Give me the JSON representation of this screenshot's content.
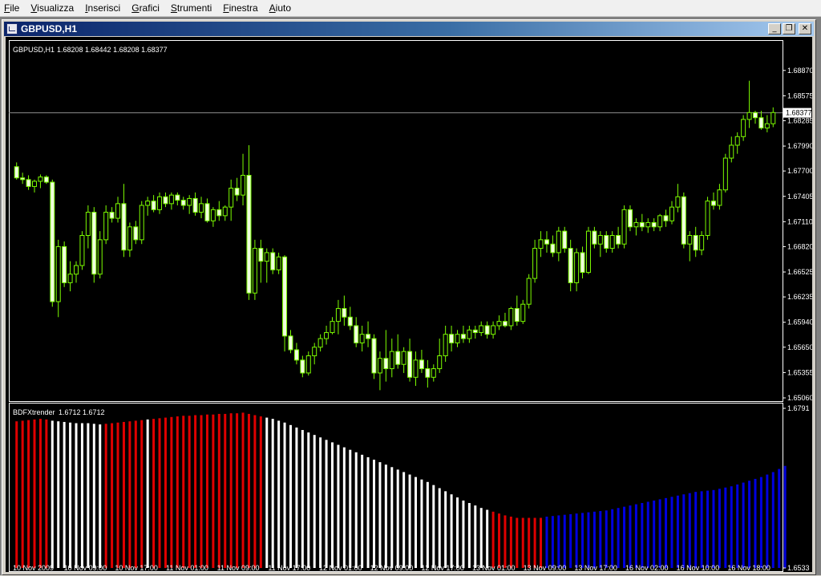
{
  "menu": [
    {
      "label": "File",
      "hotkey": "F",
      "rest": "ile"
    },
    {
      "label": "Visualizza",
      "hotkey": "V",
      "rest": "isualizza"
    },
    {
      "label": "Inserisci",
      "hotkey": "I",
      "rest": "nserisci"
    },
    {
      "label": "Grafici",
      "hotkey": "G",
      "rest": "rafici"
    },
    {
      "label": "Strumenti",
      "hotkey": "S",
      "rest": "trumenti"
    },
    {
      "label": "Finestra",
      "hotkey": "F",
      "rest": "inestra"
    },
    {
      "label": "Aiuto",
      "hotkey": "A",
      "rest": "iuto"
    }
  ],
  "window": {
    "title": "GBPUSD,H1",
    "minimize_glyph": "_",
    "restore_glyph": "❐",
    "close_glyph": "✕"
  },
  "colors": {
    "background": "#000000",
    "grid_axis": "#ffffff",
    "candle": "#7cfc00",
    "bull_fill": "#000000",
    "bear_fill": "#f0ffe0",
    "price_line": "#8c8c8c",
    "hist_red": "#e00000",
    "hist_white": "#ffffff",
    "hist_blue": "#0000e0",
    "text": "#ffffff"
  },
  "chart_data": [
    {
      "type": "candlestick",
      "title": "GBPUSD,H1",
      "ohlc_readout": "1.68208 1.68442 1.68208 1.68377",
      "current_price": "1.68377",
      "ylim": [
        1.6506,
        1.6898
      ],
      "y_ticks": [
        "1.68870",
        "1.68575",
        "1.68285",
        "1.67990",
        "1.67700",
        "1.67405",
        "1.67110",
        "1.66820",
        "1.66525",
        "1.66235",
        "1.65940",
        "1.65650",
        "1.65355",
        "1.65060"
      ],
      "candles": [
        [
          1.6775,
          1.678,
          1.676,
          1.6762
        ],
        [
          1.6762,
          1.6768,
          1.6755,
          1.676
        ],
        [
          1.676,
          1.6765,
          1.6748,
          1.6752
        ],
        [
          1.6752,
          1.676,
          1.6745,
          1.6758
        ],
        [
          1.6758,
          1.6766,
          1.675,
          1.6763
        ],
        [
          1.6763,
          1.6765,
          1.6755,
          1.6757
        ],
        [
          1.6757,
          1.676,
          1.6612,
          1.6618
        ],
        [
          1.6618,
          1.669,
          1.66,
          1.6682
        ],
        [
          1.6682,
          1.6688,
          1.6635,
          1.664
        ],
        [
          1.664,
          1.6665,
          1.663,
          1.665
        ],
        [
          1.665,
          1.6665,
          1.664,
          1.666
        ],
        [
          1.666,
          1.67,
          1.6655,
          1.6695
        ],
        [
          1.6695,
          1.673,
          1.668,
          1.6722
        ],
        [
          1.6722,
          1.6728,
          1.664,
          1.665
        ],
        [
          1.665,
          1.67,
          1.6645,
          1.669
        ],
        [
          1.669,
          1.673,
          1.6685,
          1.6722
        ],
        [
          1.6722,
          1.6728,
          1.671,
          1.6715
        ],
        [
          1.6715,
          1.674,
          1.671,
          1.6732
        ],
        [
          1.6732,
          1.6755,
          1.667,
          1.6678
        ],
        [
          1.6678,
          1.671,
          1.667,
          1.6705
        ],
        [
          1.6705,
          1.6712,
          1.6685,
          1.669
        ],
        [
          1.669,
          1.6735,
          1.6685,
          1.673
        ],
        [
          1.673,
          1.674,
          1.6718,
          1.6735
        ],
        [
          1.6735,
          1.6742,
          1.6722,
          1.6725
        ],
        [
          1.6725,
          1.6745,
          1.672,
          1.674
        ],
        [
          1.674,
          1.6745,
          1.6728,
          1.6732
        ],
        [
          1.6732,
          1.6745,
          1.6725,
          1.6742
        ],
        [
          1.6742,
          1.6745,
          1.673,
          1.6736
        ],
        [
          1.6736,
          1.674,
          1.6725,
          1.673
        ],
        [
          1.673,
          1.6742,
          1.672,
          1.6738
        ],
        [
          1.6738,
          1.6745,
          1.6718,
          1.6722
        ],
        [
          1.6722,
          1.674,
          1.6715,
          1.6732
        ],
        [
          1.6732,
          1.6738,
          1.671,
          1.6712
        ],
        [
          1.6712,
          1.6728,
          1.6705,
          1.6725
        ],
        [
          1.6725,
          1.6735,
          1.6712,
          1.6718
        ],
        [
          1.6718,
          1.673,
          1.6712,
          1.6728
        ],
        [
          1.6728,
          1.676,
          1.6712,
          1.675
        ],
        [
          1.675,
          1.6762,
          1.6735,
          1.6742
        ],
        [
          1.6742,
          1.679,
          1.673,
          1.6765
        ],
        [
          1.6765,
          1.68,
          1.662,
          1.6628
        ],
        [
          1.6628,
          1.669,
          1.662,
          1.668
        ],
        [
          1.668,
          1.669,
          1.664,
          1.6665
        ],
        [
          1.6665,
          1.668,
          1.664,
          1.6675
        ],
        [
          1.6675,
          1.668,
          1.665,
          1.6655
        ],
        [
          1.6655,
          1.6675,
          1.665,
          1.667
        ],
        [
          1.667,
          1.6672,
          1.656,
          1.6578
        ],
        [
          1.6578,
          1.6585,
          1.6558,
          1.6562
        ],
        [
          1.6562,
          1.657,
          1.6545,
          1.655
        ],
        [
          1.655,
          1.6555,
          1.653,
          1.6535
        ],
        [
          1.6535,
          1.656,
          1.6532,
          1.6555
        ],
        [
          1.6555,
          1.657,
          1.6545,
          1.6565
        ],
        [
          1.6565,
          1.658,
          1.656,
          1.6575
        ],
        [
          1.6575,
          1.659,
          1.6568,
          1.6582
        ],
        [
          1.6582,
          1.66,
          1.658,
          1.6595
        ],
        [
          1.6595,
          1.662,
          1.658,
          1.661
        ],
        [
          1.661,
          1.6625,
          1.659,
          1.66
        ],
        [
          1.66,
          1.6612,
          1.6585,
          1.659
        ],
        [
          1.659,
          1.66,
          1.6565,
          1.657
        ],
        [
          1.657,
          1.659,
          1.656,
          1.658
        ],
        [
          1.658,
          1.6595,
          1.6565,
          1.6575
        ],
        [
          1.6575,
          1.658,
          1.6528,
          1.6535
        ],
        [
          1.6535,
          1.656,
          1.6515,
          1.6552
        ],
        [
          1.6552,
          1.6585,
          1.6525,
          1.654
        ],
        [
          1.654,
          1.6575,
          1.653,
          1.656
        ],
        [
          1.656,
          1.658,
          1.654,
          1.6545
        ],
        [
          1.6545,
          1.6565,
          1.6535,
          1.656
        ],
        [
          1.656,
          1.6575,
          1.6525,
          1.653
        ],
        [
          1.653,
          1.656,
          1.652,
          1.655
        ],
        [
          1.655,
          1.6562,
          1.6535,
          1.654
        ],
        [
          1.654,
          1.655,
          1.6518,
          1.653
        ],
        [
          1.653,
          1.6545,
          1.6525,
          1.654
        ],
        [
          1.654,
          1.6575,
          1.6535,
          1.6555
        ],
        [
          1.6555,
          1.659,
          1.6548,
          1.658
        ],
        [
          1.658,
          1.659,
          1.656,
          1.657
        ],
        [
          1.657,
          1.6585,
          1.6565,
          1.658
        ],
        [
          1.658,
          1.659,
          1.657,
          1.6575
        ],
        [
          1.6575,
          1.659,
          1.657,
          1.6585
        ],
        [
          1.6585,
          1.659,
          1.6575,
          1.6582
        ],
        [
          1.6582,
          1.6595,
          1.6578,
          1.659
        ],
        [
          1.659,
          1.6595,
          1.6575,
          1.658
        ],
        [
          1.658,
          1.6595,
          1.6575,
          1.659
        ],
        [
          1.659,
          1.6602,
          1.6585,
          1.6595
        ],
        [
          1.6595,
          1.6605,
          1.6588,
          1.659
        ],
        [
          1.659,
          1.6612,
          1.6585,
          1.661
        ],
        [
          1.661,
          1.6625,
          1.659,
          1.6595
        ],
        [
          1.6595,
          1.662,
          1.6592,
          1.6615
        ],
        [
          1.6615,
          1.665,
          1.661,
          1.6645
        ],
        [
          1.6645,
          1.669,
          1.664,
          1.668
        ],
        [
          1.668,
          1.67,
          1.667,
          1.669
        ],
        [
          1.669,
          1.67,
          1.6675,
          1.6685
        ],
        [
          1.6685,
          1.6695,
          1.667,
          1.6675
        ],
        [
          1.6675,
          1.6705,
          1.6665,
          1.67
        ],
        [
          1.67,
          1.6705,
          1.6675,
          1.668
        ],
        [
          1.668,
          1.669,
          1.663,
          1.664
        ],
        [
          1.664,
          1.668,
          1.663,
          1.6675
        ],
        [
          1.6675,
          1.6682,
          1.6645,
          1.6652
        ],
        [
          1.6652,
          1.6705,
          1.665,
          1.67
        ],
        [
          1.67,
          1.6705,
          1.668,
          1.6685
        ],
        [
          1.6685,
          1.67,
          1.667,
          1.6695
        ],
        [
          1.6695,
          1.67,
          1.6675,
          1.668
        ],
        [
          1.668,
          1.67,
          1.6675,
          1.6695
        ],
        [
          1.6695,
          1.6705,
          1.668,
          1.6685
        ],
        [
          1.6685,
          1.673,
          1.668,
          1.6725
        ],
        [
          1.6725,
          1.673,
          1.67,
          1.6705
        ],
        [
          1.6705,
          1.6715,
          1.6695,
          1.671
        ],
        [
          1.671,
          1.672,
          1.67,
          1.6705
        ],
        [
          1.6705,
          1.6715,
          1.6698,
          1.671
        ],
        [
          1.671,
          1.6715,
          1.67,
          1.6705
        ],
        [
          1.6705,
          1.672,
          1.67,
          1.6718
        ],
        [
          1.6718,
          1.6725,
          1.6705,
          1.6712
        ],
        [
          1.6712,
          1.6735,
          1.6708,
          1.6728
        ],
        [
          1.6728,
          1.6755,
          1.6722,
          1.674
        ],
        [
          1.674,
          1.6745,
          1.668,
          1.6685
        ],
        [
          1.6685,
          1.67,
          1.6665,
          1.6695
        ],
        [
          1.6695,
          1.6705,
          1.667,
          1.6678
        ],
        [
          1.6678,
          1.67,
          1.6672,
          1.6695
        ],
        [
          1.6695,
          1.674,
          1.669,
          1.6735
        ],
        [
          1.6735,
          1.6745,
          1.6725,
          1.673
        ],
        [
          1.673,
          1.6755,
          1.6725,
          1.6748
        ],
        [
          1.6748,
          1.679,
          1.6745,
          1.6785
        ],
        [
          1.6785,
          1.681,
          1.678,
          1.68
        ],
        [
          1.68,
          1.6815,
          1.679,
          1.681
        ],
        [
          1.681,
          1.6835,
          1.6805,
          1.683
        ],
        [
          1.683,
          1.6875,
          1.682,
          1.6838
        ],
        [
          1.6838,
          1.684,
          1.6825,
          1.6832
        ],
        [
          1.6832,
          1.684,
          1.6818,
          1.682
        ],
        [
          1.682,
          1.6835,
          1.6815,
          1.6825
        ],
        [
          1.6825,
          1.6844,
          1.6821,
          1.6838
        ]
      ]
    },
    {
      "type": "bar",
      "title": "BDFXtrender",
      "readout": "1.6712 1.6712",
      "ylim": [
        1.6533,
        1.6791
      ],
      "y_ticks": [
        "1.6791",
        "1.6533"
      ],
      "x_tick_labels": [
        "10 Nov 2009",
        "10 Nov 09:00",
        "10 Nov 17:00",
        "11 Nov 01:00",
        "11 Nov 09:00",
        "11 Nov 17:00",
        "12 Nov 01:00",
        "12 Nov 09:00",
        "12 Nov 17:00",
        "13 Nov 01:00",
        "13 Nov 09:00",
        "13 Nov 17:00",
        "16 Nov 02:00",
        "16 Nov 10:00",
        "16 Nov 18:00"
      ],
      "values": [
        1.677,
        1.6771,
        1.6772,
        1.6773,
        1.6774,
        1.6773,
        1.6771,
        1.677,
        1.6769,
        1.6768,
        1.6767,
        1.6767,
        1.6767,
        1.6766,
        1.6765,
        1.6766,
        1.6767,
        1.6768,
        1.6769,
        1.677,
        1.6771,
        1.6772,
        1.6773,
        1.6774,
        1.6775,
        1.6776,
        1.6777,
        1.6778,
        1.6779,
        1.6779,
        1.678,
        1.678,
        1.6781,
        1.6781,
        1.6782,
        1.6782,
        1.6783,
        1.6783,
        1.6784,
        1.6782,
        1.678,
        1.6778,
        1.6776,
        1.6774,
        1.6771,
        1.6768,
        1.6764,
        1.676,
        1.6756,
        1.6752,
        1.6748,
        1.6744,
        1.674,
        1.6736,
        1.6732,
        1.6728,
        1.6724,
        1.672,
        1.6716,
        1.6712,
        1.6708,
        1.6704,
        1.67,
        1.6696,
        1.6692,
        1.6688,
        1.6684,
        1.668,
        1.6676,
        1.6672,
        1.6667,
        1.6662,
        1.6657,
        1.6652,
        1.6647,
        1.6642,
        1.6638,
        1.6634,
        1.663,
        1.6627,
        1.6624,
        1.6621,
        1.6618,
        1.6616,
        1.6614,
        1.6614,
        1.6614,
        1.6614,
        1.6614,
        1.6616,
        1.6617,
        1.6618,
        1.6619,
        1.662,
        1.6621,
        1.6622,
        1.6623,
        1.6624,
        1.6625,
        1.6626,
        1.6628,
        1.663,
        1.6632,
        1.6634,
        1.6636,
        1.6638,
        1.664,
        1.6642,
        1.6644,
        1.6646,
        1.6648,
        1.665,
        1.6652,
        1.6654,
        1.6656,
        1.6657,
        1.6658,
        1.6659,
        1.6661,
        1.6663,
        1.6665,
        1.6668,
        1.6671,
        1.6674,
        1.6677,
        1.668,
        1.6684,
        1.6688,
        1.6693,
        1.6698
      ],
      "colors": [
        "red",
        "red",
        "red",
        "red",
        "red",
        "red",
        "white",
        "white",
        "white",
        "white",
        "white",
        "white",
        "white",
        "white",
        "white",
        "red",
        "red",
        "red",
        "red",
        "red",
        "red",
        "red",
        "white",
        "red",
        "red",
        "red",
        "red",
        "red",
        "red",
        "red",
        "red",
        "red",
        "red",
        "red",
        "red",
        "red",
        "red",
        "red",
        "red",
        "red",
        "red",
        "red",
        "white",
        "white",
        "white",
        "white",
        "white",
        "white",
        "white",
        "white",
        "white",
        "white",
        "white",
        "white",
        "white",
        "white",
        "white",
        "white",
        "white",
        "white",
        "white",
        "white",
        "white",
        "white",
        "white",
        "white",
        "white",
        "white",
        "white",
        "white",
        "white",
        "white",
        "white",
        "white",
        "white",
        "white",
        "white",
        "white",
        "white",
        "white",
        "red",
        "red",
        "red",
        "red",
        "red",
        "red",
        "red",
        "red",
        "red",
        "blue",
        "blue",
        "blue",
        "blue",
        "blue",
        "blue",
        "blue",
        "blue",
        "blue",
        "blue",
        "blue",
        "blue",
        "blue",
        "blue",
        "blue",
        "blue",
        "blue",
        "blue",
        "blue",
        "blue",
        "blue",
        "blue",
        "blue",
        "blue",
        "blue",
        "blue",
        "blue",
        "blue",
        "blue",
        "blue",
        "blue",
        "blue",
        "blue",
        "blue",
        "blue",
        "blue",
        "blue",
        "blue",
        "blue",
        "blue",
        "blue"
      ]
    }
  ]
}
